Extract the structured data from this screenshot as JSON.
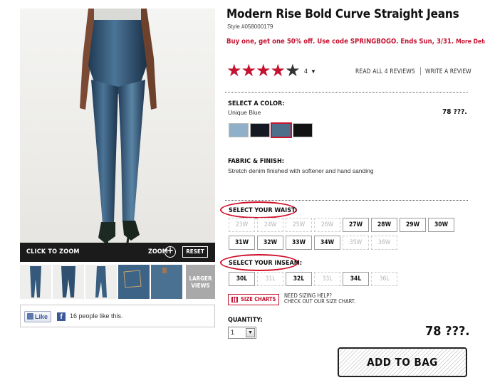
{
  "product": {
    "title": "Modern Rise Bold Curve Straight Jeans",
    "style": "Style #058000179",
    "promo": "Buy one, get one 50% off. Use code SPRINGBOGO. Ends Sun, 3/31.",
    "promo_link": "More Details"
  },
  "rating": {
    "stars_filled": 4,
    "stars_total": 5,
    "count": "4",
    "read_reviews": "READ ALL 4 REVIEWS",
    "write_review": "WRITE A REVIEW"
  },
  "color": {
    "label": "SELECT A COLOR:",
    "selected_name": "Unique Blue",
    "price": "78 ???.",
    "swatches": [
      "#8fb0c8",
      "#141822",
      "#4d6f8c",
      "#121212"
    ],
    "selected_index": 2
  },
  "fabric": {
    "label": "FABRIC & FINISH:",
    "text": "Stretch denim finished with softener and hand sanding"
  },
  "waist": {
    "label": "SELECT YOUR WAIST:",
    "sizes": [
      {
        "label": "23W",
        "available": false
      },
      {
        "label": "24W",
        "available": false
      },
      {
        "label": "25W",
        "available": false
      },
      {
        "label": "26W",
        "available": false
      },
      {
        "label": "27W",
        "available": true
      },
      {
        "label": "28W",
        "available": true
      },
      {
        "label": "29W",
        "available": true
      },
      {
        "label": "30W",
        "available": true
      },
      {
        "label": "31W",
        "available": true
      },
      {
        "label": "32W",
        "available": true
      },
      {
        "label": "33W",
        "available": true
      },
      {
        "label": "34W",
        "available": true
      },
      {
        "label": "35W",
        "available": false
      },
      {
        "label": "36W",
        "available": false
      }
    ]
  },
  "inseam": {
    "label": "SELECT YOUR INSEAM:",
    "sizes": [
      {
        "label": "30L",
        "available": true
      },
      {
        "label": "31L",
        "available": false
      },
      {
        "label": "32L",
        "available": true
      },
      {
        "label": "33L",
        "available": false
      },
      {
        "label": "34L",
        "available": true
      },
      {
        "label": "36L",
        "available": false
      }
    ]
  },
  "size_chart": {
    "button": "SIZE CHARTS",
    "help_line1": "NEED SIZING HELP?",
    "help_line2": "CHECK OUT OUR SIZE CHART."
  },
  "quantity": {
    "label": "QUANTITY:",
    "value": "1",
    "arrow": "▼"
  },
  "price": "78 ???.",
  "add_to_bag": "ADD TO BAG",
  "gallery": {
    "click_to_zoom": "CLICK TO ZOOM",
    "zoom": "ZOOM",
    "zoom_symbol": "+",
    "reset": "RESET",
    "larger_views_1": "LARGER",
    "larger_views_2": "VIEWS"
  },
  "facebook": {
    "like": "Like",
    "text": "16 people like this.",
    "logo": "f"
  }
}
